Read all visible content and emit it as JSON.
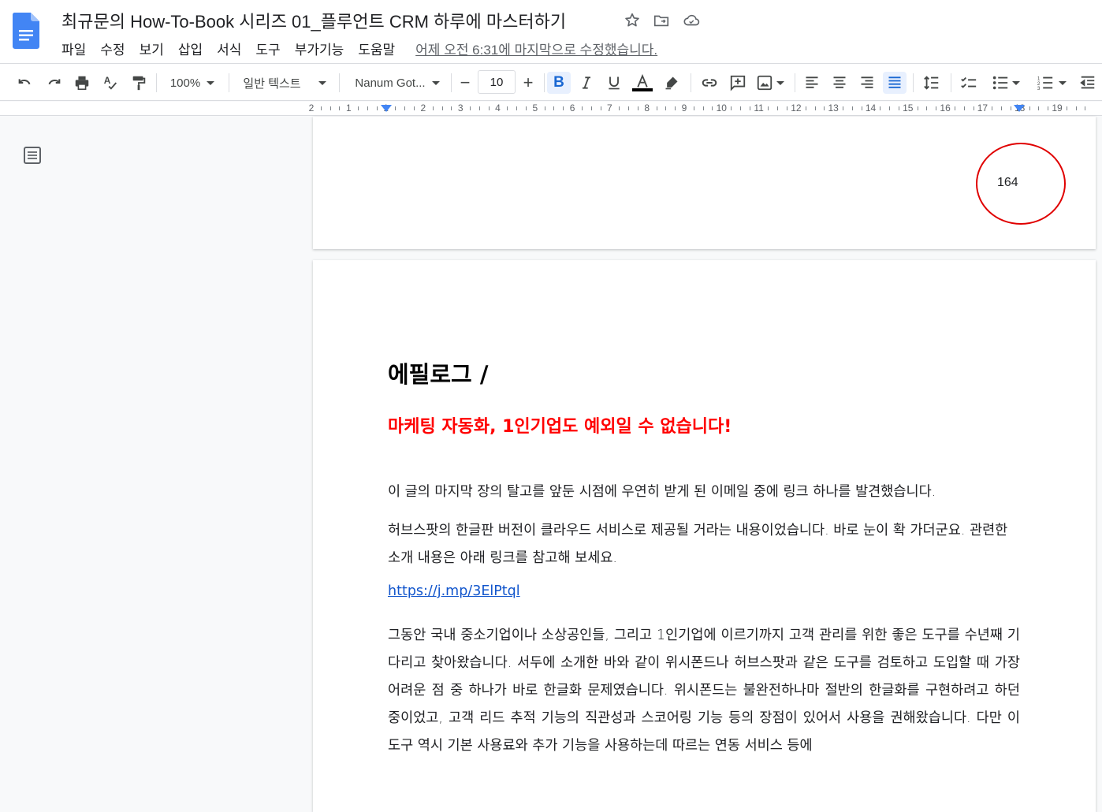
{
  "app": {
    "title": "최규문의 How-To-Book 시리즈 01_플루언트 CRM 하루에 마스터하기",
    "icons": [
      "star-icon",
      "move-to-folder-icon",
      "cloud-status-icon"
    ]
  },
  "menu": {
    "items": [
      "파일",
      "수정",
      "보기",
      "삽입",
      "서식",
      "도구",
      "부가기능",
      "도움말"
    ],
    "last_edit": "어제 오전 6:31에 마지막으로 수정했습니다."
  },
  "toolbar": {
    "zoom": "100%",
    "style": "일반 텍스트",
    "font": "Nanum Got...",
    "font_size": "10",
    "minus": "−",
    "plus": "+"
  },
  "ruler": {
    "labels": [
      "2",
      "1",
      "1",
      "2",
      "3",
      "4",
      "5",
      "6",
      "7",
      "8",
      "9",
      "10",
      "11",
      "12",
      "13",
      "14",
      "15",
      "16",
      "17",
      "18",
      "19"
    ]
  },
  "document": {
    "page_number": "164",
    "heading": "에필로그 /",
    "subtitle": "마케팅 자동화, 1인기업도 예외일 수 없습니다!",
    "para1": "이 글의 마지막 장의 탈고를 앞둔 시점에 우연히 받게 된 이메일 중에 링크 하나를 발견했습니다.",
    "para2": "허브스팟의 한글판 버전이 클라우드 서비스로 제공될 거라는 내용이었습니다. 바로 눈이 확 가더군요. 관련한 소개 내용은 아래 링크를 참고해 보세요.",
    "link": "https://j.mp/3ElPtql",
    "para3": "그동안 국내 중소기업이나 소상공인들, 그리고 1인기업에 이르기까지 고객 관리를 위한 좋은 도구를 수년째 기다리고 찾아왔습니다. 서두에 소개한 바와 같이 위시폰드나 허브스팟과 같은 도구를 검토하고 도입할 때 가장 어려운 점 중 하나가 바로 한글화 문제였습니다. 위시폰드는 불완전하나마 절반의 한글화를 구현하려고 하던 중이었고, 고객 리드 추적 기능의 직관성과 스코어링 기능 등의 장점이 있어서 사용을 권해왔습니다. 다만 이 도구 역시 기본 사용료와 추가 기능을 사용하는데 따르는 연동 서비스 등에"
  },
  "colors": {
    "accent_blue": "#1a73e8",
    "heading_red": "#ff0000",
    "circle_red": "#e00000"
  }
}
